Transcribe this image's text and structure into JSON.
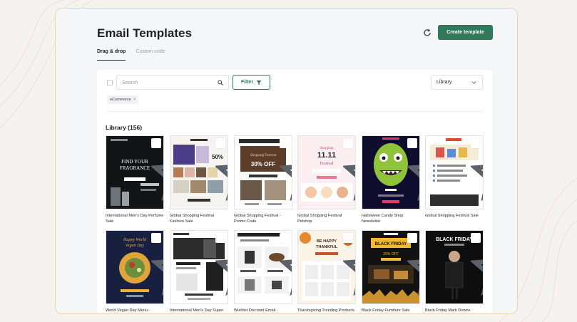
{
  "header": {
    "title": "Email Templates",
    "create_label": "Create template",
    "icons": {
      "refresh": "refresh-icon"
    }
  },
  "tabs": [
    {
      "label": "Drag & drop",
      "active": true
    },
    {
      "label": "Custom code",
      "active": false
    }
  ],
  "toolbar": {
    "search_placeholder": "Search",
    "filter_label": "Filter",
    "library_select_value": "Library"
  },
  "active_filters": [
    {
      "label": "eCommerce"
    }
  ],
  "library": {
    "heading": "Library (156)",
    "templates": [
      {
        "title": "International Men's Day Perfume Sale",
        "thumb_text": "FIND YOUR FRAGRANCE",
        "theme": "dark"
      },
      {
        "title": "Global Shopping Festival Fashion Sale",
        "thumb_text": "50%",
        "theme": "fashion"
      },
      {
        "title": "Global Shopping Festival - Promo Code",
        "thumb_text": "30% OFF",
        "theme": "promo"
      },
      {
        "title": "Global Shopping Festival Petshop",
        "thumb_text": "11.11",
        "theme": "pink"
      },
      {
        "title": "Halloween Candy Shop Newsletter",
        "thumb_text": "",
        "theme": "monster"
      },
      {
        "title": "Global Shopping Festival Sale",
        "thumb_text": "",
        "theme": "list"
      },
      {
        "title": "World Vegan Day Menu - Carousel",
        "thumb_text": "Happy World Vegan Day",
        "theme": "vegan"
      },
      {
        "title": "International Men's Day Super Sale - Product Cards",
        "thumb_text": "",
        "theme": "bw"
      },
      {
        "title": "Wishlist Discount Email - Product Cards",
        "thumb_text": "",
        "theme": "products"
      },
      {
        "title": "Thanksgiving Trending Products - Product Cards",
        "thumb_text": "BE HAPPY THANKFUL",
        "theme": "thanks"
      },
      {
        "title": "Black Friday Furniture Sale",
        "thumb_text": "BLACK FRIDAY",
        "theme": "bfgold"
      },
      {
        "title": "Black Friday Mark Downs",
        "thumb_text": "BLACK FRIDAY",
        "theme": "bfdark"
      }
    ]
  },
  "colors": {
    "accent": "#2f7a5a",
    "panel_border": "#ecd7a4"
  }
}
